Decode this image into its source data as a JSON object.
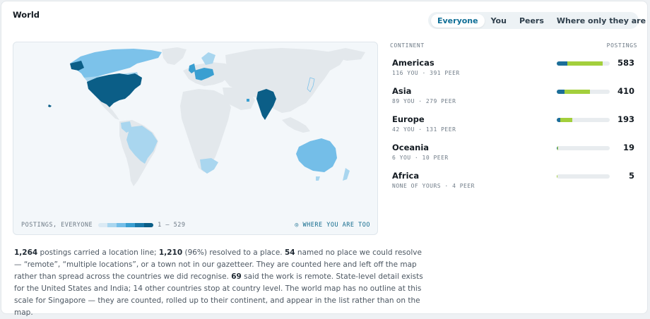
{
  "header": {
    "title": "World"
  },
  "tabs": [
    {
      "label": "Everyone",
      "active": true
    },
    {
      "label": "You",
      "active": false
    },
    {
      "label": "Peers",
      "active": false
    },
    {
      "label": "Where only they are",
      "active": false
    }
  ],
  "map": {
    "legend_label": "POSTINGS, EVERYONE",
    "legend_range": "1 – 529",
    "legend_colors": [
      "#dbeaf4",
      "#a9d6ef",
      "#74bee8",
      "#3a9fd1",
      "#1a78a8",
      "#0b5e87"
    ],
    "where_you_label": "◎ WHERE YOU ARE TOO",
    "colors": {
      "land": "#e3e8ec",
      "usa": "#0b5e87",
      "india": "#0b5e87",
      "americas": "#7cc2ea",
      "australia": "#74bee8",
      "brazil": "#a9d6ef",
      "europe": "#3a9fd1",
      "light": "#a9d6ef"
    }
  },
  "list": {
    "col_left": "CONTINENT",
    "col_right": "POSTINGS",
    "regions": [
      {
        "name": "Americas",
        "sub": "116 YOU · 391 PEER",
        "total": "583",
        "you": 116,
        "peer": 391
      },
      {
        "name": "Asia",
        "sub": "89 YOU · 279 PEER",
        "total": "410",
        "you": 89,
        "peer": 279
      },
      {
        "name": "Europe",
        "sub": "42 YOU · 131 PEER",
        "total": "193",
        "you": 42,
        "peer": 131
      },
      {
        "name": "Oceania",
        "sub": "6 YOU · 10 PEER",
        "total": "19",
        "you": 6,
        "peer": 10
      },
      {
        "name": "Africa",
        "sub": "NONE OF YOURS · 4 PEER",
        "total": "5",
        "you": 0,
        "peer": 4
      }
    ],
    "max_total": 583,
    "colors": {
      "you": "#1c6e98",
      "peer": "#a3cf3c",
      "track": "#e8ecef"
    }
  },
  "note": {
    "n1": "1,264",
    "t1": " postings carried a location line; ",
    "n2": "1,210",
    "t2": " (96%) resolved to a place. ",
    "n3": "54",
    "t3": " named no place we could resolve — “remote”, “multiple locations”, or a town not in our gazetteer. They are counted here and left off the map rather than spread across the countries we did recognise. ",
    "n4": "69",
    "t4": " said the work is remote. State-level detail exists for the United States and India; 14 other countries stop at country level. The world map has no outline at this scale for Singapore — they are counted, rolled up to their continent, and appear in the list rather than on the map."
  }
}
